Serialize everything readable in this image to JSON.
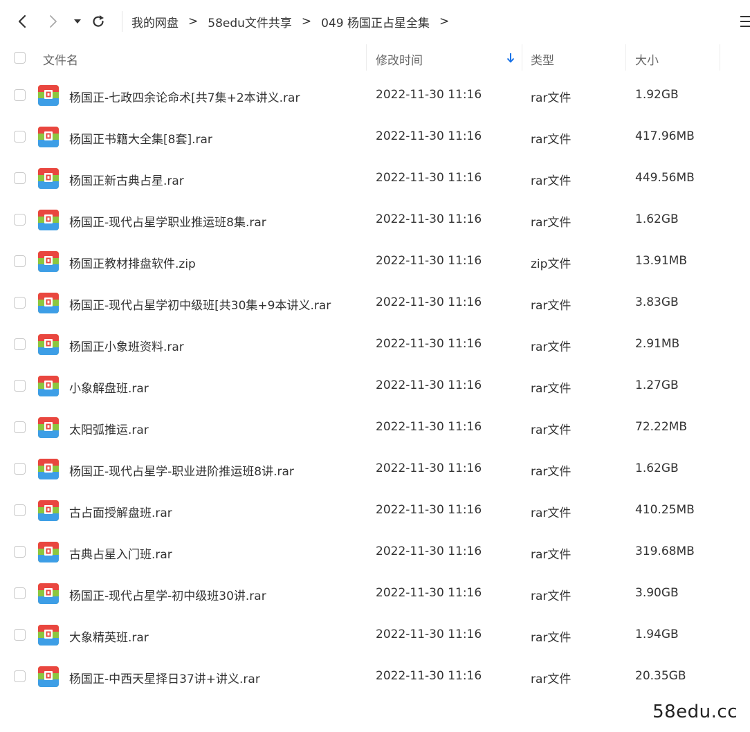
{
  "breadcrumb": {
    "items": [
      "我的网盘",
      "58edu文件共享",
      "049 杨国正占星全集"
    ],
    "separator": ">"
  },
  "columns": {
    "name": "文件名",
    "modified": "修改时间",
    "type": "类型",
    "size": "大小"
  },
  "files": [
    {
      "name": "杨国正-七政四余论命术[共7集+2本讲义.rar",
      "modified": "2022-11-30 11:16",
      "type": "rar文件",
      "size": "1.92GB"
    },
    {
      "name": "杨国正书籍大全集[8套].rar",
      "modified": "2022-11-30 11:16",
      "type": "rar文件",
      "size": "417.96MB"
    },
    {
      "name": "杨国正新古典占星.rar",
      "modified": "2022-11-30 11:16",
      "type": "rar文件",
      "size": "449.56MB"
    },
    {
      "name": "杨国正-现代占星学职业推运班8集.rar",
      "modified": "2022-11-30 11:16",
      "type": "rar文件",
      "size": "1.62GB"
    },
    {
      "name": "杨国正教材排盘软件.zip",
      "modified": "2022-11-30 11:16",
      "type": "zip文件",
      "size": "13.91MB"
    },
    {
      "name": "杨国正-现代占星学初中级班[共30集+9本讲义.rar",
      "modified": "2022-11-30 11:16",
      "type": "rar文件",
      "size": "3.83GB"
    },
    {
      "name": "杨国正小象班资料.rar",
      "modified": "2022-11-30 11:16",
      "type": "rar文件",
      "size": "2.91MB"
    },
    {
      "name": "小象解盘班.rar",
      "modified": "2022-11-30 11:16",
      "type": "rar文件",
      "size": "1.27GB"
    },
    {
      "name": "太阳弧推运.rar",
      "modified": "2022-11-30 11:16",
      "type": "rar文件",
      "size": "72.22MB"
    },
    {
      "name": "杨国正-现代占星学-职业进阶推运班8讲.rar",
      "modified": "2022-11-30 11:16",
      "type": "rar文件",
      "size": "1.62GB"
    },
    {
      "name": "古占面授解盘班.rar",
      "modified": "2022-11-30 11:16",
      "type": "rar文件",
      "size": "410.25MB"
    },
    {
      "name": "古典占星入门班.rar",
      "modified": "2022-11-30 11:16",
      "type": "rar文件",
      "size": "319.68MB"
    },
    {
      "name": "杨国正-现代占星学-初中级班30讲.rar",
      "modified": "2022-11-30 11:16",
      "type": "rar文件",
      "size": "3.90GB"
    },
    {
      "name": "大象精英班.rar",
      "modified": "2022-11-30 11:16",
      "type": "rar文件",
      "size": "1.94GB"
    },
    {
      "name": "杨国正-中西天星择日37讲+讲义.rar",
      "modified": "2022-11-30 11:16",
      "type": "rar文件",
      "size": "20.35GB"
    }
  ],
  "watermark": "58edu.cc",
  "colors": {
    "accent": "#1a73e8",
    "text": "#333333",
    "header_text": "#666666"
  },
  "icons": {
    "back": "chevron-left-icon",
    "forward": "chevron-right-icon",
    "dropdown": "caret-down-icon",
    "refresh": "refresh-icon",
    "menu": "menu-icon",
    "sort": "sort-down-arrow-icon",
    "file": "archive-file-icon"
  }
}
